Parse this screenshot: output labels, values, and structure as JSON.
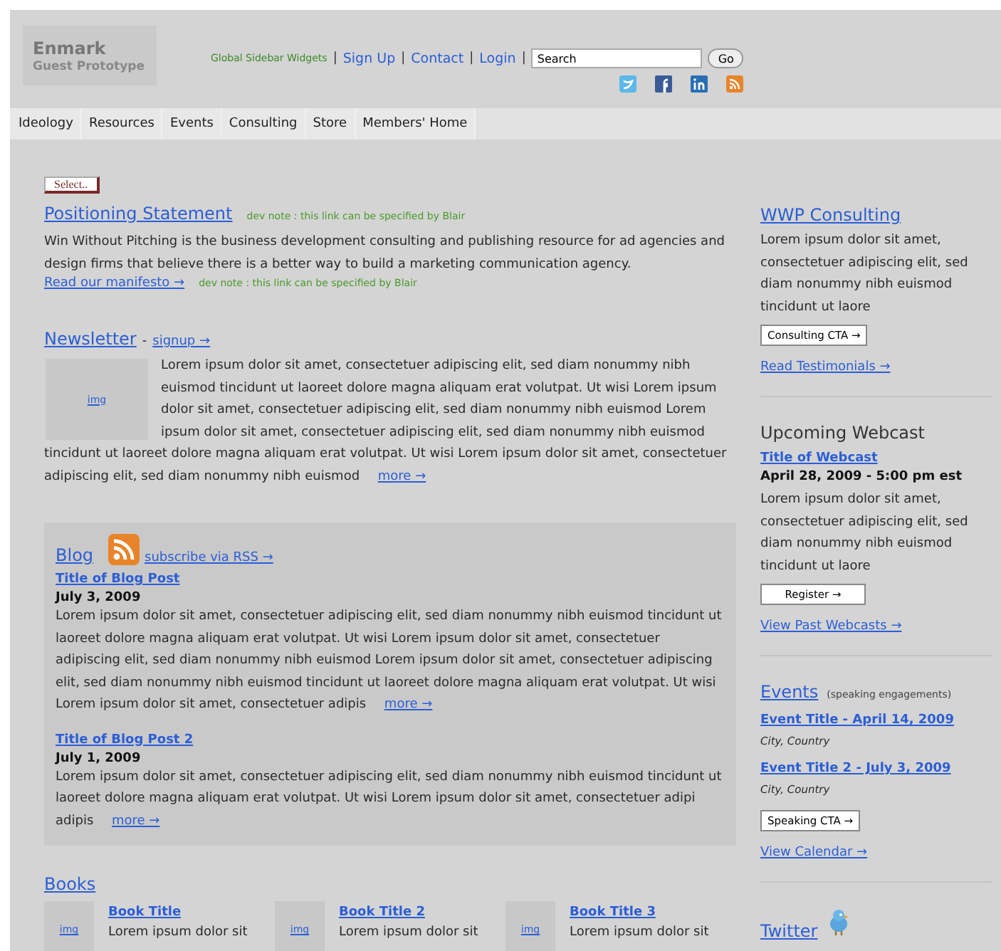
{
  "header": {
    "logo": {
      "name": "Enmark",
      "subtitle": "Guest Prototype"
    },
    "links": [
      {
        "label": "Global Sidebar Widgets",
        "kind": "note"
      },
      {
        "label": "Sign Up",
        "kind": "link"
      },
      {
        "label": "Contact",
        "kind": "link"
      },
      {
        "label": "Login",
        "kind": "link"
      }
    ],
    "separator": "|",
    "search": {
      "value": "Search",
      "button": "Go"
    },
    "social": [
      {
        "kind": "twitter"
      },
      {
        "kind": "facebook"
      },
      {
        "kind": "linkedin"
      },
      {
        "kind": "rss"
      }
    ]
  },
  "nav": [
    "Ideology",
    "Resources",
    "Events",
    "Consulting",
    "Store",
    "Members' Home"
  ],
  "main": {
    "select": "Select..",
    "positioning": {
      "title": "Positioning Statement",
      "note": "dev note : this link can be specified by Blair",
      "text": "Win Without Pitching is the business development consulting and publishing resource for ad agencies and design firms that believe there is a better way to build a marketing communication agency.",
      "link": "Read our manifesto →",
      "link_note": "dev note : this link can be specified by Blair"
    },
    "newsletter": {
      "title": "Newsletter",
      "separator": "-",
      "link": "signup →",
      "image": "img",
      "text_beside_image": "Lorem ipsum dolor sit amet, consectetuer adipiscing elit, sed diam nonummy nibh euismod tincidunt ut laoreet dolore magna aliquam erat volutpat. Ut wisi Lorem ipsum dolor sit amet, consectetuer adipiscing elit, sed diam nonummy nibh euismod Lorem ipsum dolor sit amet, consectetuer adipiscing elit, sed diam nonummy nibh euismod",
      "text_below": "tincidunt ut laoreet dolore magna aliquam erat volutpat. Ut wisi Lorem ipsum dolor sit amet, consectetuer adipiscing elit, sed diam nonummy nibh euismod",
      "more": "more →"
    },
    "blog": {
      "title": "Blog",
      "link": "subscribe via RSS →",
      "posts": [
        {
          "title": "Title of Blog Post",
          "date": "July 3, 2009",
          "text": "Lorem ipsum dolor sit amet, consectetuer adipiscing elit, sed diam nonummy nibh euismod tincidunt ut laoreet dolore magna aliquam erat volutpat. Ut wisi Lorem ipsum dolor sit amet, consectetuer adipiscing elit, sed diam nonummy nibh euismod Lorem ipsum dolor sit amet, consectetuer adipiscing elit, sed diam nonummy nibh euismod tincidunt ut laoreet dolore magna aliquam erat volutpat. Ut wisi Lorem ipsum dolor sit amet, consectetuer adipis",
          "more": "more →"
        },
        {
          "title": "Title of Blog Post 2",
          "date": "July 1, 2009",
          "text": "Lorem ipsum dolor sit amet, consectetuer adipiscing elit, sed diam nonummy nibh euismod tincidunt ut laoreet dolore magna aliquam erat volutpat. Ut wisi Lorem ipsum dolor sit amet, consectetuer adipi adipis",
          "more": "more →"
        }
      ]
    },
    "books": {
      "title": "Books",
      "items": [
        {
          "image": "img",
          "title": "Book Title",
          "text": "Lorem ipsum dolor sit"
        },
        {
          "image": "img",
          "title": "Book Title 2",
          "text": "Lorem ipsum dolor sit"
        },
        {
          "image": "img",
          "title": "Book Title 3",
          "text": "Lorem ipsum dolor sit"
        }
      ]
    }
  },
  "sidebar": {
    "consulting": {
      "title": "WWP Consulting",
      "text": "Lorem ipsum dolor sit amet, consectetuer adipiscing elit, sed diam nonummy nibh euismod tincidunt ut laore",
      "button": "Consulting CTA →",
      "link": "Read Testimonials →"
    },
    "webcast": {
      "title": "Upcoming Webcast",
      "item_title": "Title of Webcast",
      "date": "April 28, 2009 - 5:00 pm est",
      "text": "Lorem ipsum dolor sit amet, consectetuer adipiscing elit, sed diam nonummy nibh euismod tincidunt ut laore",
      "button": "Register →",
      "link": "View Past Webcasts →"
    },
    "events": {
      "title": "Events",
      "subtitle": "(speaking engagements)",
      "items": [
        {
          "title": "Event Title - April 14, 2009",
          "place": "City, Country"
        },
        {
          "title": "Event Title 2 - July 3, 2009",
          "place": "City, Country"
        }
      ],
      "button": "Speaking CTA →",
      "link": "View Calendar →"
    },
    "twitter": {
      "title": "Twitter"
    }
  }
}
